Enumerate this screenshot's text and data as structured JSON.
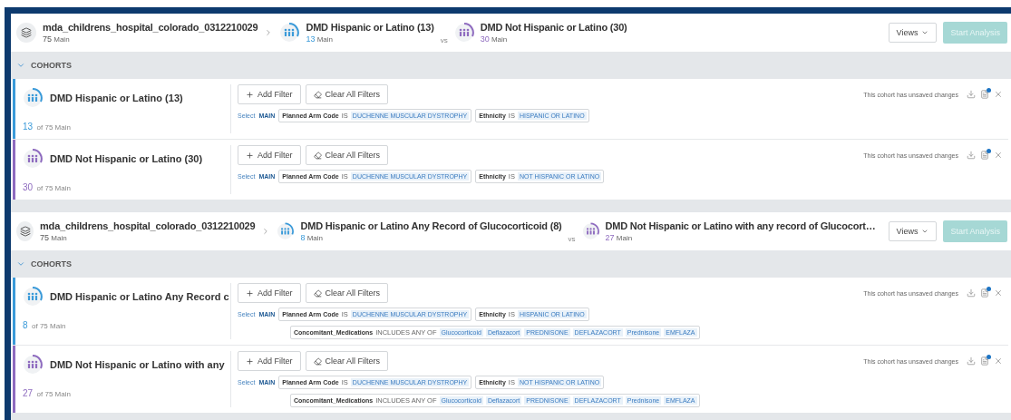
{
  "panels": [
    {
      "dataset": {
        "name": "mda_childrens_hospital_colorado_0312210029",
        "count": "75",
        "unit": "Main"
      },
      "compare": [
        {
          "name": "DMD Hispanic or Latino (13)",
          "count": "13",
          "unit": "Main",
          "color": "#3a9ad9"
        },
        {
          "name": "DMD Not Hispanic or Latino (30)",
          "count": "30",
          "unit": "Main",
          "color": "#8e6bbf"
        }
      ],
      "vs": "vs",
      "views": "Views",
      "start": {
        "label": "Start Analysis",
        "disabled": true
      },
      "section": {
        "label": "COHORTS",
        "expanded": true
      },
      "cohorts": [
        {
          "name": "DMD Hispanic or Latino (13)",
          "count": "13",
          "of": "of 75 Main",
          "color": "#3a9ad9",
          "add": "Add Filter",
          "clear": "Clear All Filters",
          "select": "Select",
          "source": "MAIN",
          "status": "This cohort has unsaved changes",
          "unsaved": true,
          "filters": [
            [
              {
                "field": "Planned Arm Code",
                "op": "IS",
                "values": [
                  "DUCHENNE MUSCULAR DYSTROPHY"
                ]
              },
              {
                "field": "Ethnicity",
                "op": "IS",
                "values": [
                  "HISPANIC OR LATINO"
                ]
              }
            ]
          ]
        },
        {
          "name": "DMD Not Hispanic or Latino (30)",
          "count": "30",
          "of": "of 75 Main",
          "color": "#8e6bbf",
          "add": "Add Filter",
          "clear": "Clear All Filters",
          "select": "Select",
          "source": "MAIN",
          "status": "This cohort has unsaved changes",
          "unsaved": true,
          "filters": [
            [
              {
                "field": "Planned Arm Code",
                "op": "IS",
                "values": [
                  "DUCHENNE MUSCULAR DYSTROPHY"
                ]
              },
              {
                "field": "Ethnicity",
                "op": "IS",
                "values": [
                  "NOT HISPANIC OR LATINO"
                ]
              }
            ]
          ]
        }
      ]
    },
    {
      "dataset": {
        "name": "mda_childrens_hospital_colorado_0312210029",
        "count": "75",
        "unit": "Main"
      },
      "compare": [
        {
          "name": "DMD Hispanic or Latino Any Record of Glucocorticoid (8)",
          "count": "8",
          "unit": "Main",
          "color": "#3a9ad9"
        },
        {
          "name": "DMD Not Hispanic or Latino with any record of Glucocort…",
          "count": "27",
          "unit": "Main",
          "color": "#8e6bbf"
        }
      ],
      "vs": "vs",
      "views": "Views",
      "start": {
        "label": "Start Analysis",
        "disabled": true
      },
      "section": {
        "label": "COHORTS",
        "expanded": true
      },
      "cohorts": [
        {
          "name": "DMD Hispanic or Latino Any Record c",
          "count": "8",
          "of": "of 75 Main",
          "color": "#3a9ad9",
          "add": "Add Filter",
          "clear": "Clear All Filters",
          "select": "Select",
          "source": "MAIN",
          "status": "This cohort has unsaved changes",
          "unsaved": true,
          "filters": [
            [
              {
                "field": "Planned Arm Code",
                "op": "IS",
                "values": [
                  "DUCHENNE MUSCULAR DYSTROPHY"
                ]
              },
              {
                "field": "Ethnicity",
                "op": "IS",
                "values": [
                  "HISPANIC OR LATINO"
                ]
              }
            ],
            [
              {
                "field": "Concomitant_Medications",
                "op": "INCLUDES ANY OF",
                "values": [
                  "Glucocorticoid",
                  "Deflazacort",
                  "PREDNISONE",
                  "DEFLAZACORT",
                  "Prednisone",
                  "EMFLAZA"
                ]
              }
            ]
          ]
        },
        {
          "name": "DMD Not Hispanic or Latino with any",
          "count": "27",
          "of": "of 75 Main",
          "color": "#8e6bbf",
          "add": "Add Filter",
          "clear": "Clear All Filters",
          "select": "Select",
          "source": "MAIN",
          "status": "This cohort has unsaved changes",
          "unsaved": true,
          "filters": [
            [
              {
                "field": "Planned Arm Code",
                "op": "IS",
                "values": [
                  "DUCHENNE MUSCULAR DYSTROPHY"
                ]
              },
              {
                "field": "Ethnicity",
                "op": "IS",
                "values": [
                  "NOT HISPANIC OR LATINO"
                ]
              }
            ],
            [
              {
                "field": "Concomitant_Medications",
                "op": "INCLUDES ANY OF",
                "values": [
                  "Glucocorticoid",
                  "Deflazacort",
                  "PREDNISONE",
                  "DEFLAZACORT",
                  "Prednisone",
                  "EMFLAZA"
                ]
              }
            ]
          ]
        }
      ]
    }
  ]
}
